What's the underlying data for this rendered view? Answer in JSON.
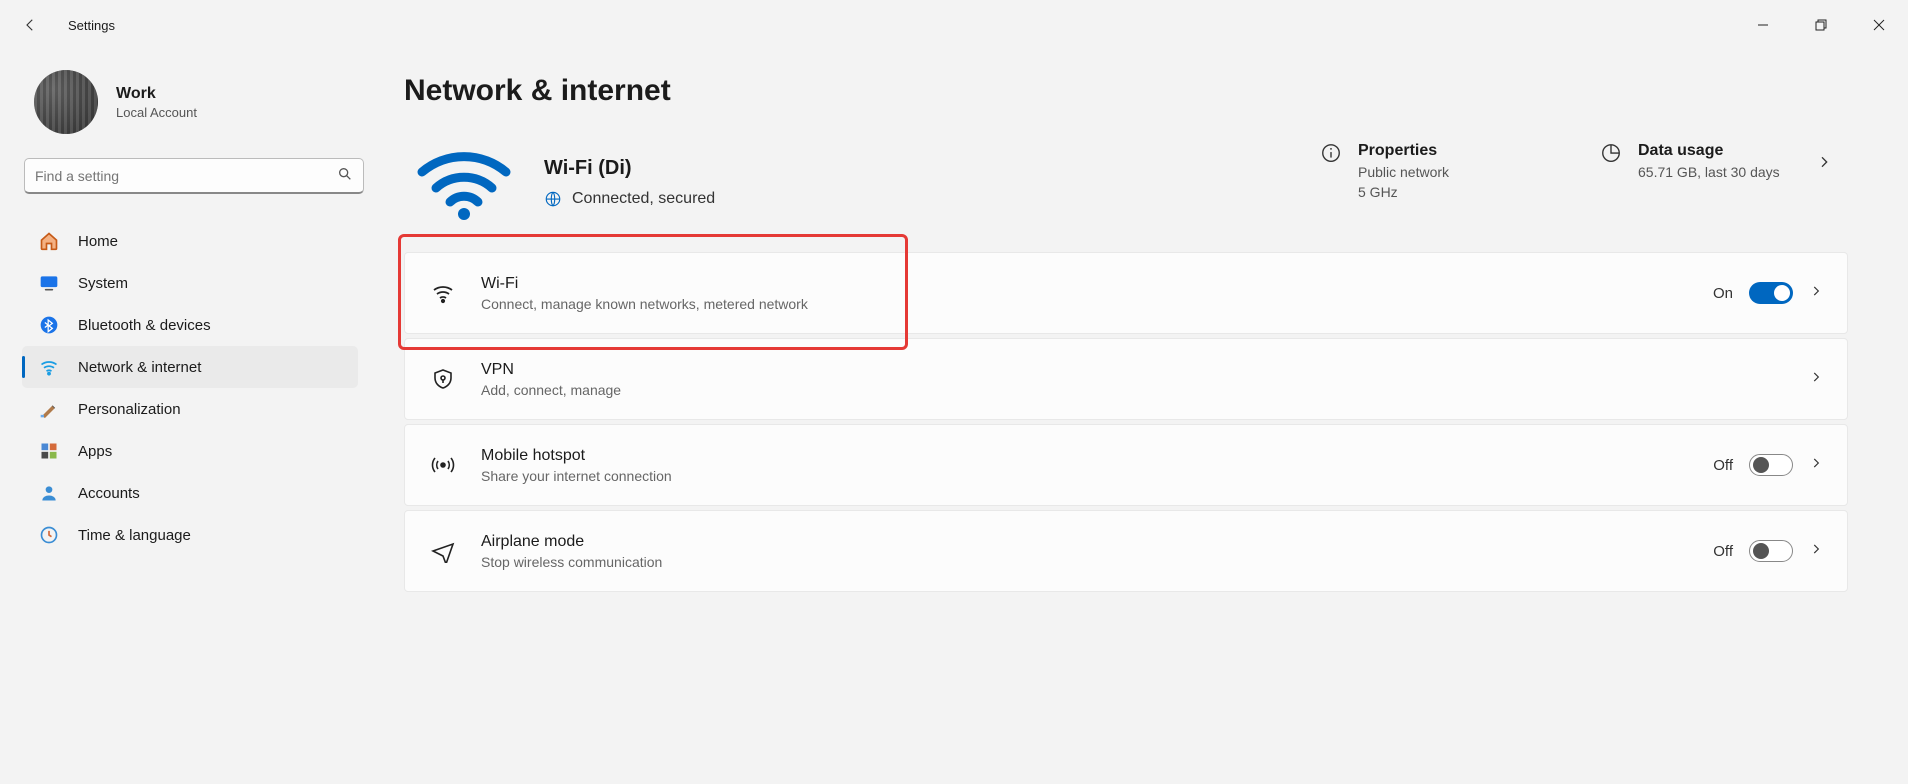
{
  "app_title": "Settings",
  "window": {
    "minimize": "–",
    "maximize": "❐",
    "close": "✕"
  },
  "profile": {
    "name": "Work",
    "subtitle": "Local Account"
  },
  "search": {
    "placeholder": "Find a setting"
  },
  "sidebar": {
    "items": [
      {
        "label": "Home",
        "active": false
      },
      {
        "label": "System",
        "active": false
      },
      {
        "label": "Bluetooth & devices",
        "active": false
      },
      {
        "label": "Network & internet",
        "active": true
      },
      {
        "label": "Personalization",
        "active": false
      },
      {
        "label": "Apps",
        "active": false
      },
      {
        "label": "Accounts",
        "active": false
      },
      {
        "label": "Time & language",
        "active": false
      }
    ]
  },
  "page": {
    "title": "Network & internet",
    "status": {
      "ssid": "Wi-Fi (Di)",
      "state": "Connected, secured",
      "properties": {
        "title": "Properties",
        "line1": "Public network",
        "line2": "5 GHz"
      },
      "data_usage": {
        "title": "Data usage",
        "line1": "65.71 GB, last 30 days"
      }
    },
    "rows": [
      {
        "title": "Wi-Fi",
        "subtitle": "Connect, manage known networks, metered network",
        "toggle_label": "On",
        "toggle_on": true
      },
      {
        "title": "VPN",
        "subtitle": "Add, connect, manage",
        "toggle_label": "",
        "toggle_on": null
      },
      {
        "title": "Mobile hotspot",
        "subtitle": "Share your internet connection",
        "toggle_label": "Off",
        "toggle_on": false
      },
      {
        "title": "Airplane mode",
        "subtitle": "Stop wireless communication",
        "toggle_label": "Off",
        "toggle_on": false
      }
    ]
  }
}
